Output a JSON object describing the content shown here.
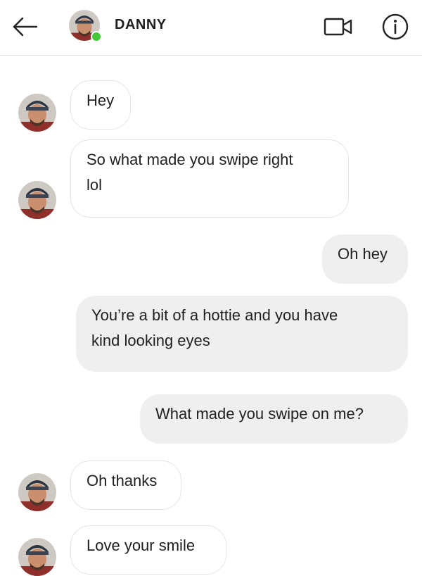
{
  "header": {
    "contact_name": "DANNY",
    "online": true,
    "icons": [
      "back-arrow-icon",
      "video-call-icon",
      "info-icon"
    ]
  },
  "messages": [
    {
      "direction": "incoming",
      "text": "Hey"
    },
    {
      "direction": "incoming",
      "text": "So what made you swipe right\nlol"
    },
    {
      "direction": "outgoing",
      "text": "Oh hey"
    },
    {
      "direction": "outgoing",
      "text": "You’re a bit of a hottie and you have\nkind looking eyes"
    },
    {
      "direction": "outgoing",
      "text": "What made you swipe on me?"
    },
    {
      "direction": "incoming",
      "text": "Oh thanks"
    },
    {
      "direction": "incoming",
      "text": "Love your smile"
    }
  ],
  "colors": {
    "incoming_bubble": "#ffffff",
    "outgoing_bubble": "#efefef",
    "online_indicator": "#45c93b"
  }
}
